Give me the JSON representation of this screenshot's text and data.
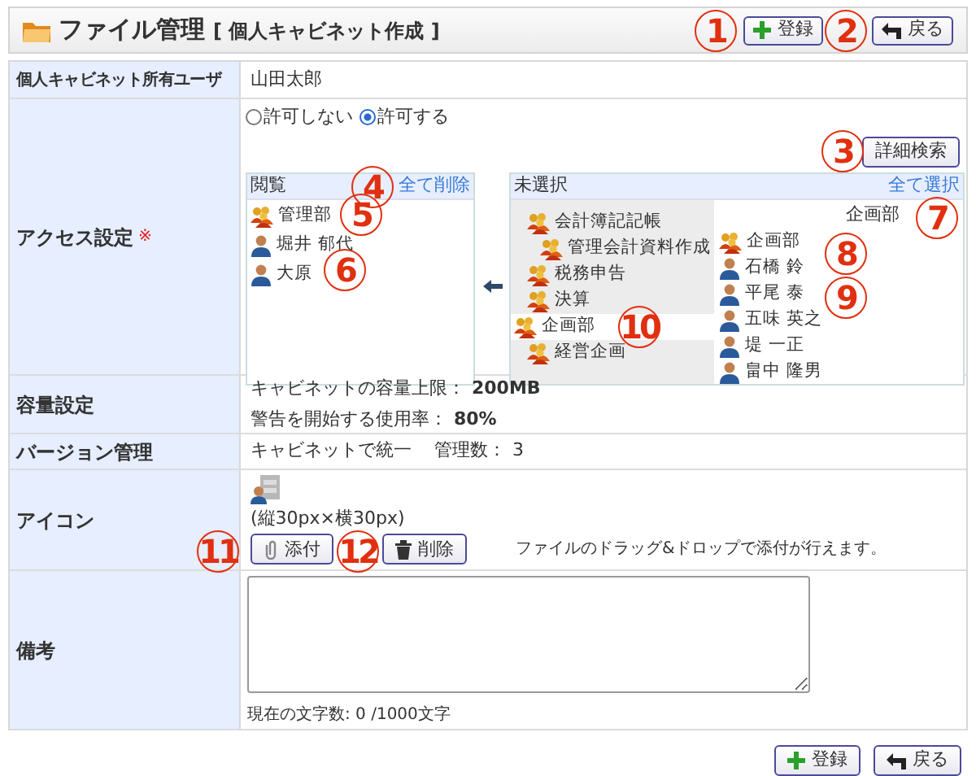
{
  "header": {
    "title": "ファイル管理",
    "subtitle": "[ 個人キャビネット作成 ]",
    "buttons": [
      {
        "label": "登録",
        "kind": "add"
      },
      {
        "label": "戻る",
        "kind": "back"
      }
    ]
  },
  "owner": {
    "label": "個人キャビネット所有ユーザ",
    "value": "山田太郎"
  },
  "access": {
    "label": "アクセス設定",
    "required_mark": "※",
    "radios": [
      {
        "label": "許可しない",
        "selected": false
      },
      {
        "label": "許可する",
        "selected": true
      }
    ],
    "search_button": "詳細検索",
    "left_box": {
      "title": "閲覧",
      "action": "全て削除",
      "items": [
        {
          "kind": "group",
          "label": "管理部"
        },
        {
          "kind": "person",
          "label": "堀井 郁代"
        },
        {
          "kind": "person",
          "label": "大原"
        }
      ]
    },
    "right_box": {
      "title": "未選択",
      "action": "全て選択",
      "tree": [
        {
          "children": [
            {
              "label": "会計簿記記帳",
              "selected": false,
              "children": [
                {
                  "label": "管理会計資料作成",
                  "selected": false
                }
              ]
            },
            {
              "label": "税務申告",
              "selected": false
            },
            {
              "label": "決算",
              "selected": false
            }
          ]
        },
        {
          "label": "企画部",
          "selected": true,
          "children": [
            {
              "label": "経営企画",
              "selected": false
            }
          ]
        }
      ],
      "list_title": "企画部",
      "items": [
        {
          "kind": "group",
          "label": "企画部"
        },
        {
          "kind": "person",
          "label": "石橋 鈴"
        },
        {
          "kind": "person",
          "label": "平尾 泰"
        },
        {
          "kind": "person",
          "label": "五味 英之"
        },
        {
          "kind": "person",
          "label": "堤 一正"
        },
        {
          "kind": "person",
          "label": "畠中 隆男"
        }
      ]
    }
  },
  "capacity": {
    "label": "容量設定",
    "lines": [
      {
        "text": "キャビネットの容量上限：",
        "value": "200MB"
      },
      {
        "text": "警告を開始する使用率：",
        "value": "80%"
      }
    ]
  },
  "version": {
    "label": "バージョン管理",
    "mode": "キャビネットで統一",
    "count_label": "管理数：",
    "count": "3"
  },
  "icon": {
    "label": "アイコン",
    "size_note": "(縦30px×横30px)",
    "buttons": [
      {
        "label": "添付",
        "kind": "attach"
      },
      {
        "label": "削除",
        "kind": "delete"
      }
    ],
    "hint": "ファイルのドラッグ&ドロップで添付が行えます。"
  },
  "notes": {
    "label": "備考",
    "counter": "現在の文字数: 0 /1000文字"
  },
  "footer_buttons": [
    {
      "label": "登録",
      "kind": "add"
    },
    {
      "label": "戻る",
      "kind": "back"
    }
  ],
  "callouts": [
    "1",
    "2",
    "3",
    "4",
    "5",
    "6",
    "7",
    "8",
    "9",
    "10",
    "11",
    "12"
  ]
}
